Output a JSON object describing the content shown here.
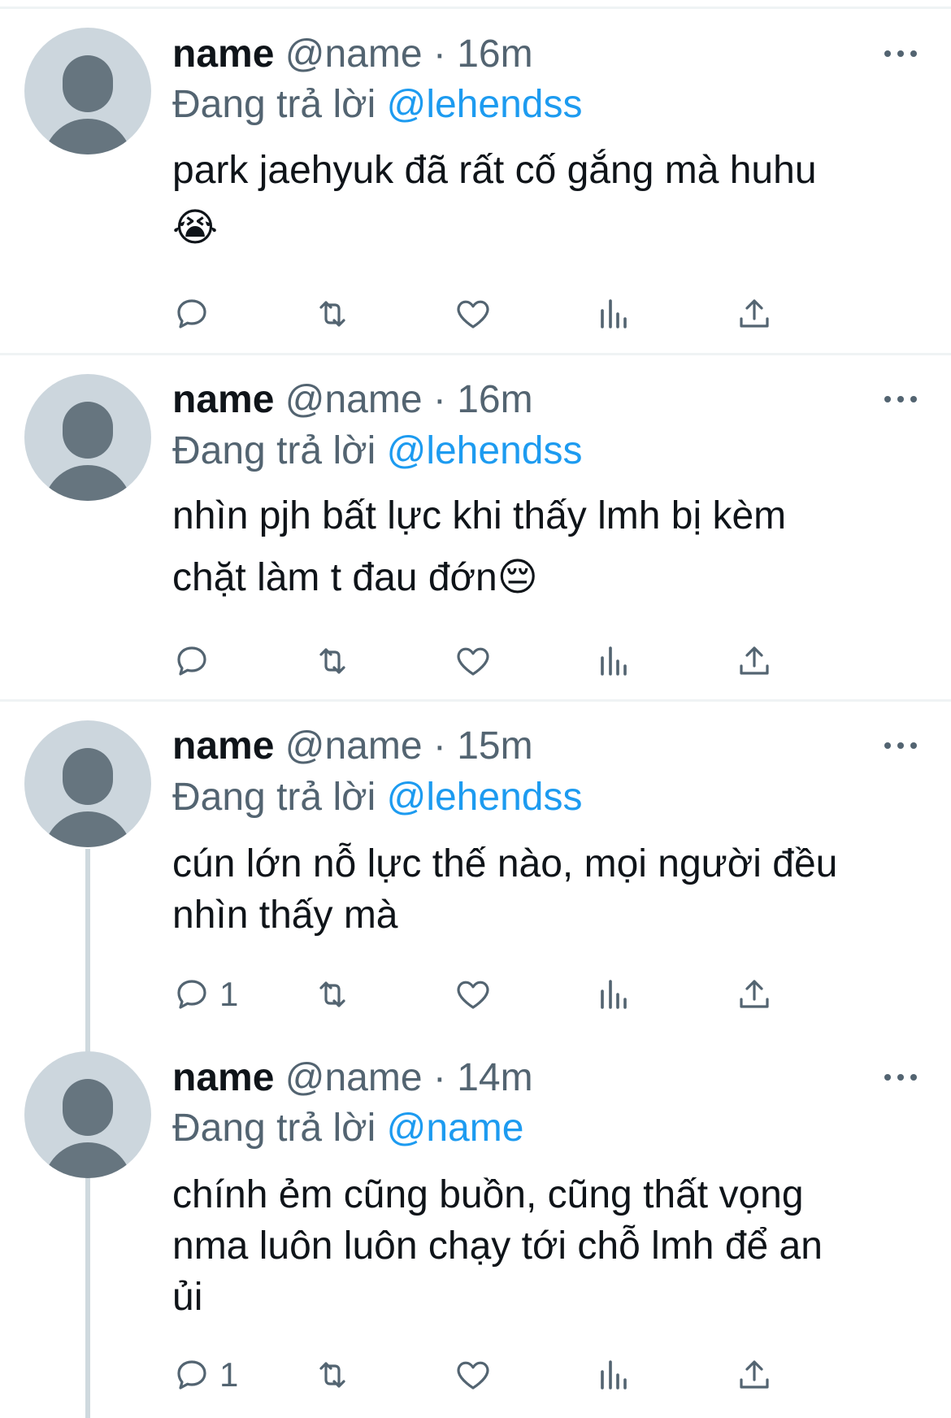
{
  "tweets": [
    {
      "name": "name",
      "handle": "@name",
      "separator": "·",
      "time": "16m",
      "reply_prefix": "Đang trả lời",
      "reply_to": "@lehendss",
      "text_lines": [
        "park jaehyuk đã rất cố gắng mà huhu",
        "😭"
      ],
      "reply_count": ""
    },
    {
      "name": "name",
      "handle": "@name",
      "separator": "·",
      "time": "16m",
      "reply_prefix": "Đang trả lời",
      "reply_to": "@lehendss",
      "text_lines": [
        "nhìn pjh bất lực khi thấy lmh bị kèm",
        "chặt làm t đau đớn😔"
      ],
      "reply_count": ""
    },
    {
      "name": "name",
      "handle": "@name",
      "separator": "·",
      "time": "15m",
      "reply_prefix": "Đang trả lời",
      "reply_to": "@lehendss",
      "text_lines": [
        "cún lớn nỗ lực thế nào, mọi người đều",
        "nhìn thấy mà"
      ],
      "reply_count": "1"
    },
    {
      "name": "name",
      "handle": "@name",
      "separator": "·",
      "time": "14m",
      "reply_prefix": "Đang trả lời",
      "reply_to": "@name",
      "text_lines": [
        "chính ẻm cũng buồn, cũng thất vọng",
        "nma luôn luôn chạy tới chỗ lmh để an",
        "ủi"
      ],
      "reply_count": "1"
    }
  ],
  "icons": {
    "reply": "reply-icon",
    "retweet": "retweet-icon",
    "like": "heart-icon",
    "views": "views-icon",
    "share": "share-icon",
    "more": "more-icon"
  },
  "colors": {
    "text": "#0f1419",
    "secondary": "#536471",
    "mention": "#1d9bf0",
    "divider": "#eff3f4",
    "avatar_bg": "#ccd6dd",
    "avatar_fg": "#66757f"
  }
}
